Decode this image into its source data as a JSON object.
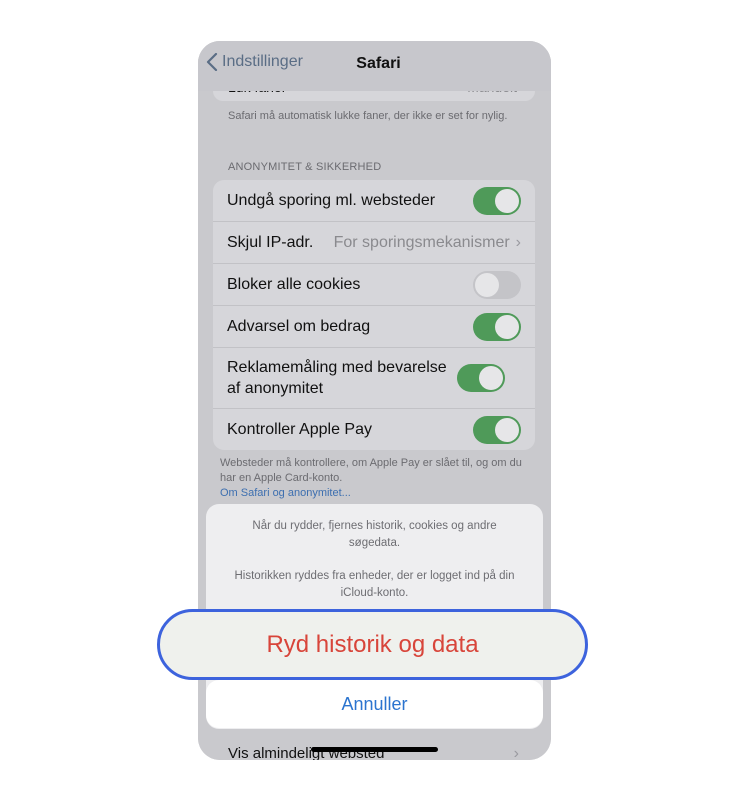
{
  "nav": {
    "back_label": "Indstillinger",
    "title": "Safari"
  },
  "partial_row": {
    "label": "Luk faner",
    "value": "Manuelt"
  },
  "footnote_top": "Safari må automatisk lukke faner, der ikke er set for nylig.",
  "section_header": "ANONYMITET & SIKKERHED",
  "rows": [
    {
      "label": "Undgå sporing ml. websteder",
      "toggle": "on"
    },
    {
      "label": "Skjul IP-adr.",
      "value": "For sporingsmekanismer"
    },
    {
      "label": "Bloker alle cookies",
      "toggle": "off"
    },
    {
      "label": "Advarsel om bedrag",
      "toggle": "on"
    },
    {
      "label": "Reklamemåling med bevarelse af anonymitet",
      "toggle": "on"
    },
    {
      "label": "Kontroller Apple Pay",
      "toggle": "on"
    }
  ],
  "footnote_bottom": {
    "text": "Websteder må kontrollere, om Apple Pay er slået til, og om du har en Apple Card-konto.",
    "link": "Om Safari og anonymitet..."
  },
  "sheet": {
    "message_1": "Når du rydder, fjernes historik, cookies og andre søgedata.",
    "message_2": "Historikken ryddes fra enheder, der er logget ind på din iCloud-konto.",
    "destructive_label": "Ryd historik og data",
    "cancel_label": "Annuller"
  },
  "bottom_row": {
    "label": "Vis almindeligt websted"
  },
  "colors": {
    "toggle_on": "#4f9a59",
    "destructive": "#d8453a",
    "highlight_border": "#3d63dd",
    "link": "#2b74cf"
  }
}
